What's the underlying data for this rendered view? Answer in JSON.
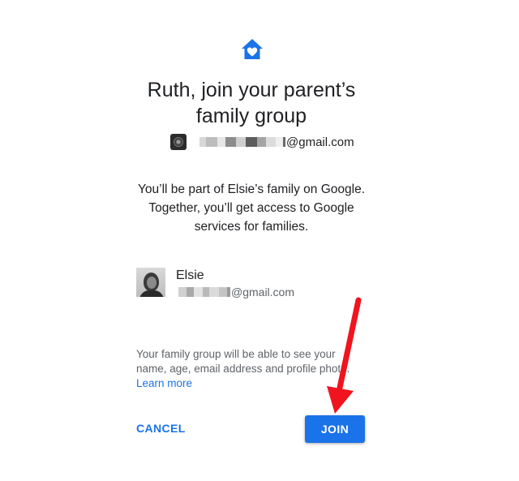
{
  "icons": {
    "logo": "family-home-heart-icon"
  },
  "colors": {
    "accent": "#1a73e8",
    "annotation_arrow": "#f0141e"
  },
  "header": {
    "title_line1": "Ruth, join your parent’s",
    "title_line2": "family group"
  },
  "account": {
    "email_suffix": "@gmail.com"
  },
  "description": {
    "line1": "You’ll be part of Elsie’s family on Google.",
    "line2": "Together, you’ll get access to Google",
    "line3": "services for families."
  },
  "parent": {
    "name": "Elsie",
    "email_suffix": "@gmail.com"
  },
  "footnote": {
    "line1": "Your family group will be able to see your",
    "line2": "name, age, email address and profile photo.",
    "learn_more": "Learn more"
  },
  "actions": {
    "cancel_label": "CANCEL",
    "join_label": "JOIN"
  }
}
